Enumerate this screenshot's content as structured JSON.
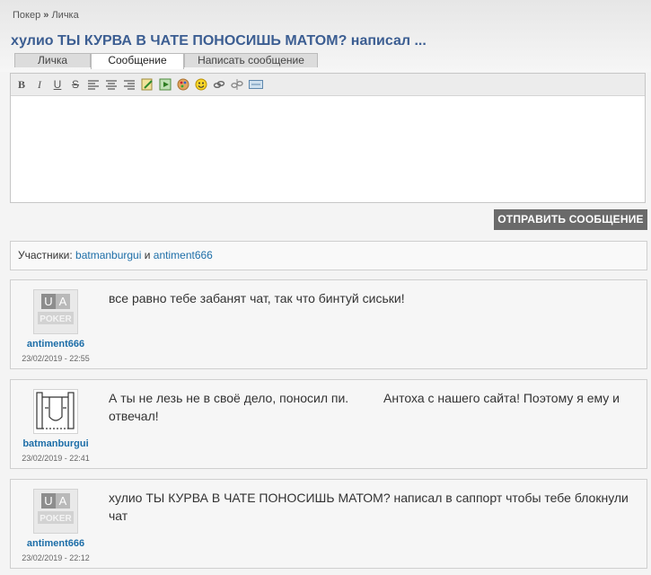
{
  "breadcrumb": {
    "root": "Покер",
    "sep": "»",
    "current": "Личка"
  },
  "title": "хулио ТЫ КУРВА В ЧАТЕ ПОНОСИШЬ МАТОМ? написал ...",
  "tabs": [
    {
      "label": "Личка"
    },
    {
      "label": "Сообщение"
    },
    {
      "label": "Написать сообщение"
    }
  ],
  "toolbar": {
    "bold": "B",
    "italic": "I",
    "underline": "U",
    "strike": "S"
  },
  "send_button": "ОТПРАВИТЬ СООБЩЕНИЕ",
  "participants": {
    "label": "Участники:",
    "user1": "batmanburgui",
    "conj": "и",
    "user2": "antiment666"
  },
  "messages": [
    {
      "author": "antiment666",
      "date": "23/02/2019 - 22:55",
      "text": "все равно тебе забанят чат, так что бинтуй сиськи!",
      "avatar_letters": [
        "U",
        "A"
      ],
      "avatar_word": "POKER"
    },
    {
      "author": "batmanburgui",
      "date": "23/02/2019 - 22:41",
      "text": "А ты не лезь не в своё дело, поносил пи.          Антоха с нашего сайта! Поэтому я ему и отвечал!"
    },
    {
      "author": "antiment666",
      "date": "23/02/2019 - 22:12",
      "text": "хулио ТЫ КУРВА В ЧАТЕ ПОНОСИШЬ МАТОМ? написал в саппорт чтобы тебе блокнули чат",
      "avatar_letters": [
        "U",
        "A"
      ],
      "avatar_word": "POKER"
    }
  ]
}
